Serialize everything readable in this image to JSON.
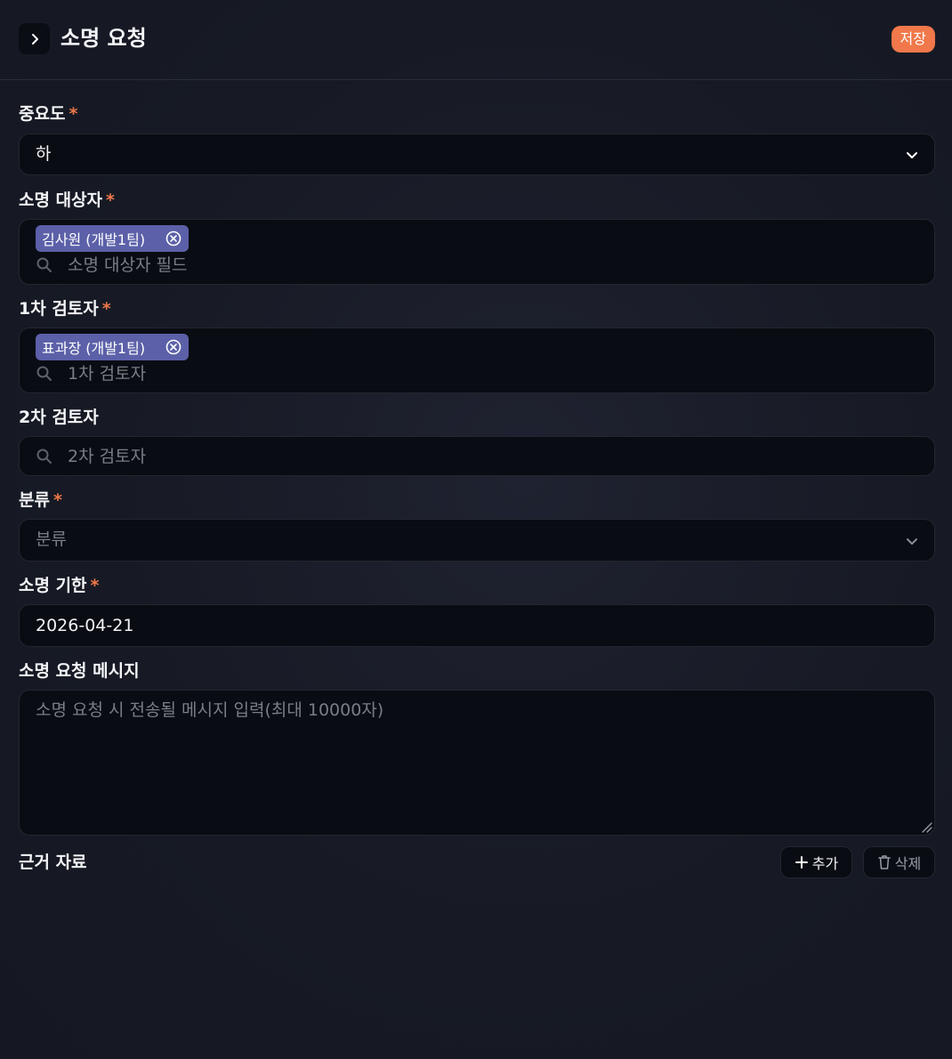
{
  "header": {
    "title": "소명 요청",
    "save_label": "저장"
  },
  "fields": {
    "importance": {
      "label": "중요도",
      "required_mark": "*",
      "value": "하"
    },
    "target": {
      "label": "소명 대상자",
      "required_mark": "*",
      "chips": [
        {
          "label": "김사원 (개발1팀)"
        }
      ],
      "placeholder": "소명 대상자 필드"
    },
    "reviewer1": {
      "label": "1차 검토자",
      "required_mark": "*",
      "chips": [
        {
          "label": "표과장 (개발1팀)"
        }
      ],
      "placeholder": "1차 검토자"
    },
    "reviewer2": {
      "label": "2차 검토자",
      "placeholder": "2차 검토자"
    },
    "category": {
      "label": "분류",
      "required_mark": "*",
      "placeholder": "분류"
    },
    "deadline": {
      "label": "소명 기한",
      "required_mark": "*",
      "value": "2026-04-21"
    },
    "message": {
      "label": "소명 요청 메시지",
      "placeholder": "소명 요청 시 전송될 메시지 입력(최대 10000자)"
    },
    "evidence": {
      "label": "근거 자료",
      "add_label": "추가",
      "delete_label": "삭제"
    }
  },
  "icons": {
    "collapse": "chevron-right-icon",
    "dropdown": "chevron-down-icon",
    "chip_remove": "circle-x-icon",
    "search": "search-icon",
    "add": "plus-icon",
    "delete": "trash-icon"
  },
  "colors": {
    "accent": "#f0784a",
    "chip": "#5b60a8",
    "field_bg": "#0a0c13"
  }
}
